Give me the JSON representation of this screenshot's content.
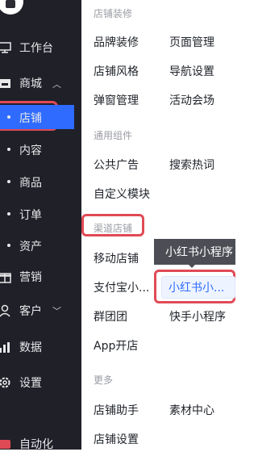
{
  "sidebar": {
    "items": [
      {
        "label": "工作台",
        "icon": "monitor-icon"
      },
      {
        "label": "商城",
        "icon": "store-icon"
      },
      {
        "label": "营销",
        "icon": "gift-icon"
      },
      {
        "label": "客户",
        "icon": "user-icon"
      },
      {
        "label": "数据",
        "icon": "bar-chart-icon"
      },
      {
        "label": "设置",
        "icon": "gear-icon"
      },
      {
        "label": "自动化",
        "icon": "automation-icon"
      }
    ],
    "mall_subitems": [
      "店铺",
      "内容",
      "商品",
      "订单",
      "资产"
    ],
    "active_subitem": "店铺",
    "colors": {
      "background": "#1f2028",
      "active": "#2f6bff",
      "highlight_outline": "#e04a55"
    }
  },
  "panel": {
    "sections": [
      {
        "title": "店铺装修",
        "links": [
          "品牌装修",
          "页面管理",
          "店铺风格",
          "导航设置",
          "弹窗管理",
          "活动会场"
        ]
      },
      {
        "title": "通用组件",
        "links": [
          "公共广告",
          "搜索热词",
          "自定义模块"
        ]
      },
      {
        "title": "渠道店铺",
        "links": [
          "移动店铺",
          "支付宝小...",
          "小红书小...",
          "群团团",
          "快手小程序",
          "App开店"
        ]
      },
      {
        "title": "更多",
        "links": [
          "店铺助手",
          "素材中心",
          "店铺设置"
        ]
      }
    ],
    "tooltip": "小红书小程序",
    "hovered_link": "小红书小..."
  }
}
